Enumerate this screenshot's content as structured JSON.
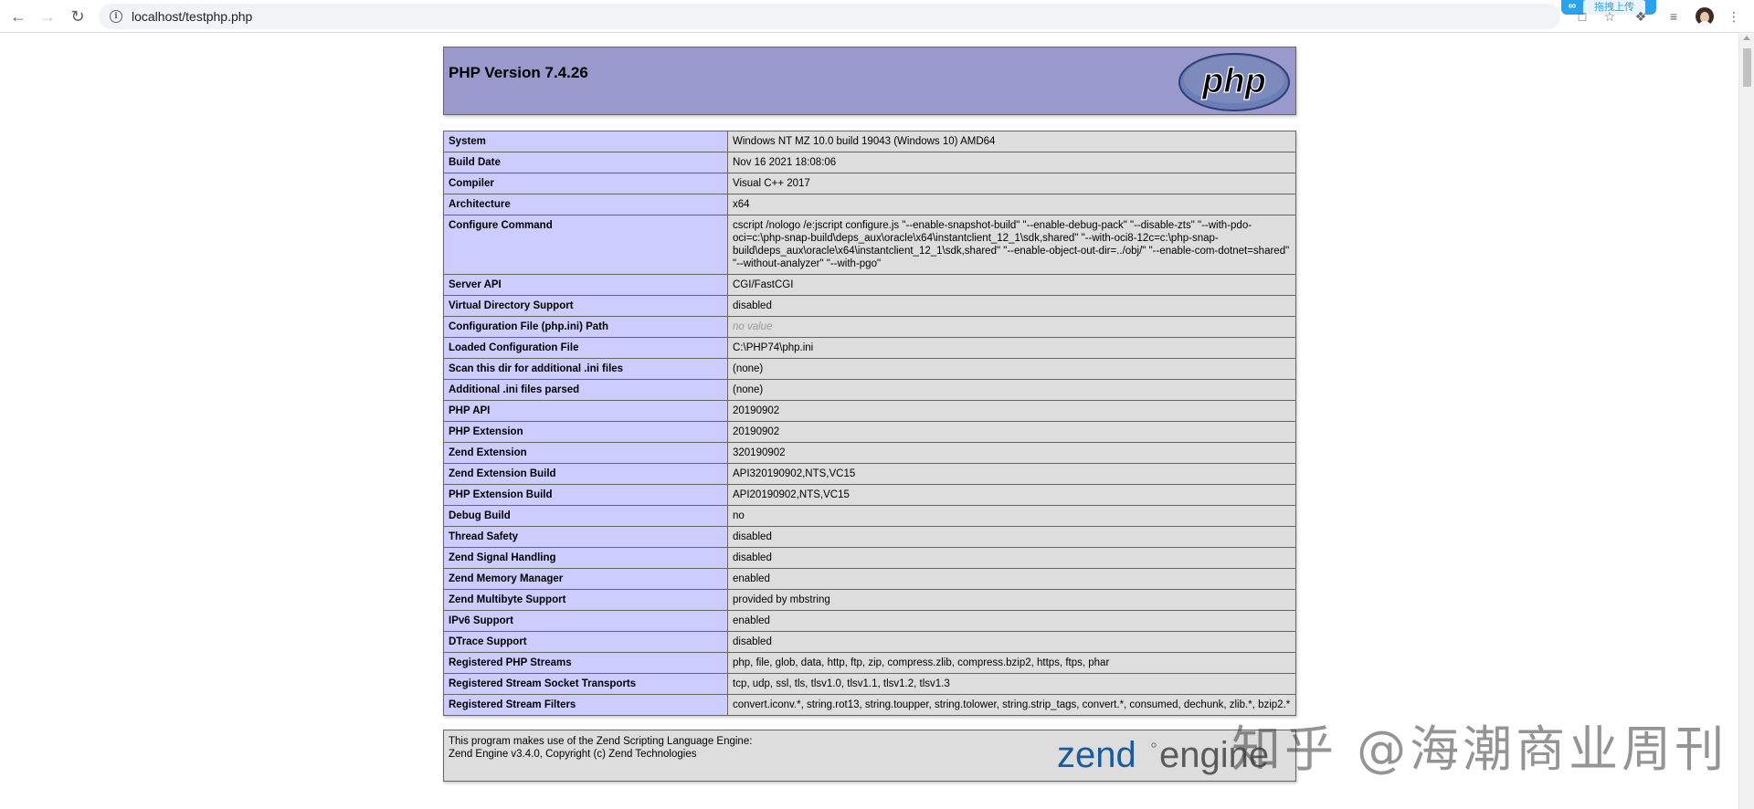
{
  "browser": {
    "url": "localhost/testphp.php",
    "upload_label": "拖拽上传"
  },
  "header": {
    "title": "PHP Version 7.4.26",
    "logo_text": "php"
  },
  "rows": [
    {
      "key": "System",
      "value": "Windows NT MZ 10.0 build 19043 (Windows 10) AMD64"
    },
    {
      "key": "Build Date",
      "value": "Nov 16 2021 18:08:06"
    },
    {
      "key": "Compiler",
      "value": "Visual C++ 2017"
    },
    {
      "key": "Architecture",
      "value": "x64"
    },
    {
      "key": "Configure Command",
      "value": "cscript /nologo /e:jscript configure.js \"--enable-snapshot-build\" \"--enable-debug-pack\" \"--disable-zts\" \"--with-pdo-oci=c:\\php-snap-build\\deps_aux\\oracle\\x64\\instantclient_12_1\\sdk,shared\" \"--with-oci8-12c=c:\\php-snap-build\\deps_aux\\oracle\\x64\\instantclient_12_1\\sdk,shared\" \"--enable-object-out-dir=../obj/\" \"--enable-com-dotnet=shared\" \"--without-analyzer\" \"--with-pgo\""
    },
    {
      "key": "Server API",
      "value": "CGI/FastCGI"
    },
    {
      "key": "Virtual Directory Support",
      "value": "disabled"
    },
    {
      "key": "Configuration File (php.ini) Path",
      "value": "no value",
      "novalue": true
    },
    {
      "key": "Loaded Configuration File",
      "value": "C:\\PHP74\\php.ini"
    },
    {
      "key": "Scan this dir for additional .ini files",
      "value": "(none)"
    },
    {
      "key": "Additional .ini files parsed",
      "value": "(none)"
    },
    {
      "key": "PHP API",
      "value": "20190902"
    },
    {
      "key": "PHP Extension",
      "value": "20190902"
    },
    {
      "key": "Zend Extension",
      "value": "320190902"
    },
    {
      "key": "Zend Extension Build",
      "value": "API320190902,NTS,VC15"
    },
    {
      "key": "PHP Extension Build",
      "value": "API20190902,NTS,VC15"
    },
    {
      "key": "Debug Build",
      "value": "no"
    },
    {
      "key": "Thread Safety",
      "value": "disabled"
    },
    {
      "key": "Zend Signal Handling",
      "value": "disabled"
    },
    {
      "key": "Zend Memory Manager",
      "value": "enabled"
    },
    {
      "key": "Zend Multibyte Support",
      "value": "provided by mbstring"
    },
    {
      "key": "IPv6 Support",
      "value": "enabled"
    },
    {
      "key": "DTrace Support",
      "value": "disabled"
    },
    {
      "key": "Registered PHP Streams",
      "value": "php, file, glob, data, http, ftp, zip, compress.zlib, compress.bzip2, https, ftps, phar"
    },
    {
      "key": "Registered Stream Socket Transports",
      "value": "tcp, udp, ssl, tls, tlsv1.0, tlsv1.1, tlsv1.2, tlsv1.3"
    },
    {
      "key": "Registered Stream Filters",
      "value": "convert.iconv.*, string.rot13, string.toupper, string.tolower, string.strip_tags, convert.*, consumed, dechunk, zlib.*, bzip2.*"
    }
  ],
  "zend": {
    "line1": "This program makes use of the Zend Scripting Language Engine:",
    "line2": "Zend Engine v3.4.0, Copyright (c) Zend Technologies",
    "logo_word1": "zend",
    "logo_word2": "engine"
  },
  "watermark": "知乎 @海潮商业周刊",
  "colors": {
    "header_bg": "#9999cc",
    "key_bg": "#ccccff",
    "value_bg": "#dddddd",
    "zend_blue": "#1a5a9e",
    "zend_green": "#5b5b5b"
  }
}
